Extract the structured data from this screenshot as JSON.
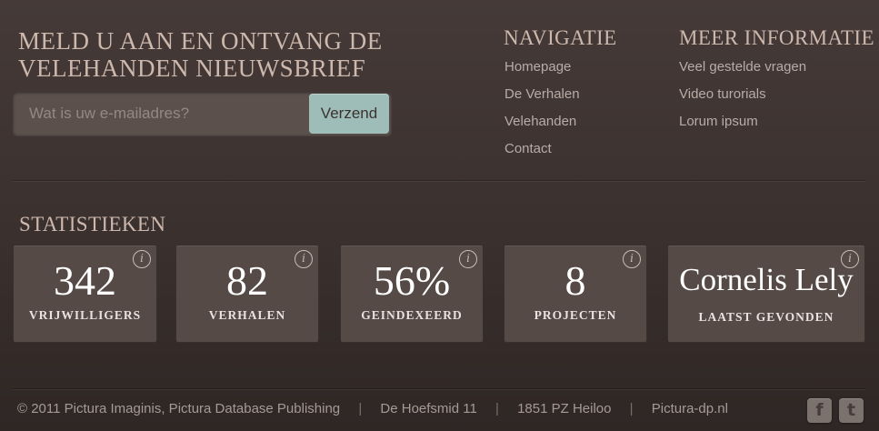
{
  "newsletter": {
    "title": "MELD U AAN EN ONTVANG DE VELEHANDEN NIEUWSBRIEF",
    "email_placeholder": "Wat is uw e-mailadres?",
    "submit_label": "Verzend"
  },
  "navigation": {
    "heading": "NAVIGATIE",
    "items": [
      {
        "label": "Homepage"
      },
      {
        "label": "De Verhalen"
      },
      {
        "label": "Velehanden"
      },
      {
        "label": "Contact"
      }
    ]
  },
  "more_info": {
    "heading": "MEER INFORMATIE",
    "items": [
      {
        "label": "Veel gestelde vragen"
      },
      {
        "label": "Video turorials"
      },
      {
        "label": "Lorum ipsum"
      }
    ]
  },
  "statistics": {
    "heading": "STATISTIEKEN",
    "cards": [
      {
        "value": "342",
        "label": "VRIJWILLIGERS"
      },
      {
        "value": "82",
        "label": "VERHALEN"
      },
      {
        "value": "56%",
        "label": "GEINDEXEERD"
      },
      {
        "value": "8",
        "label": "PROJECTEN"
      },
      {
        "value": "Cornelis Lely",
        "label": "LAATST GEVONDEN"
      }
    ],
    "info_icon": "i"
  },
  "footer": {
    "copyright": "© 2011 Pictura Imaginis, Pictura Database Publishing",
    "address": "De Hoefsmid 11",
    "city": "1851 PZ Heiloo",
    "website": "Pictura-dp.nl",
    "separator": "|",
    "social": [
      {
        "name": "facebook-icon",
        "glyph": "f"
      },
      {
        "name": "twitter-icon",
        "glyph": "t"
      }
    ]
  },
  "colors": {
    "background": "#3f3532",
    "accent_button": "#9fbdb8",
    "heading": "#cdb8ad",
    "card": "#554a46"
  }
}
